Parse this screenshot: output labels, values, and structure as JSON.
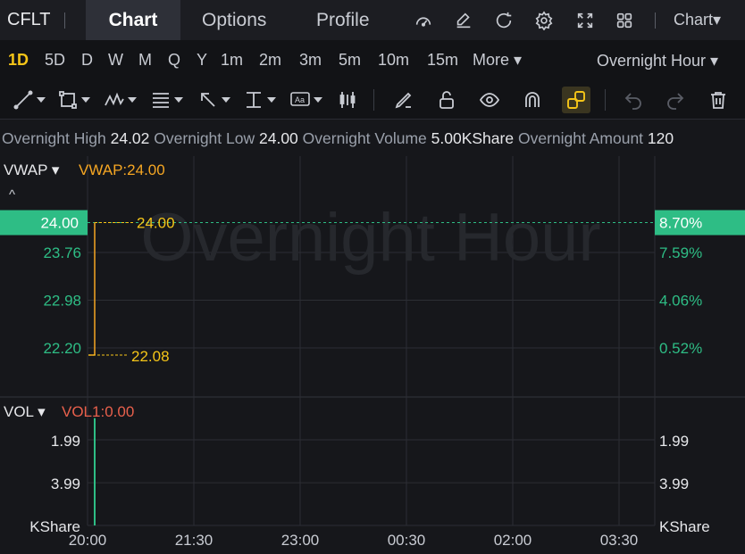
{
  "header": {
    "ticker": "CFLT",
    "tabs": [
      "Chart",
      "Options",
      "Profile"
    ],
    "active_tab": "Chart",
    "icons": [
      "gauge-icon",
      "edit-note-icon",
      "refresh-icon",
      "settings-gear-icon",
      "fullscreen-icon",
      "grid-layout-icon"
    ],
    "chart_menu_label": "Chart▾"
  },
  "intervals": {
    "items": [
      "1D",
      "5D",
      "D",
      "W",
      "M",
      "Q",
      "Y",
      "1m",
      "2m",
      "3m",
      "5m",
      "10m",
      "15m",
      "More ▾"
    ],
    "active": "1D",
    "session_select": "Overnight Hour ▾"
  },
  "toolbar": {
    "tools": [
      "line-tool-icon",
      "rectangle-tool-icon",
      "pattern-tool-icon",
      "fibonacci-tool-icon",
      "arrow-tool-icon",
      "measure-tool-icon",
      "text-note-tool-icon",
      "candlestick-tool-icon",
      "pencil-icon",
      "unlock-icon",
      "eye-icon",
      "magnet-icon",
      "link-toggle-icon",
      "undo-icon",
      "redo-icon",
      "trash-icon"
    ]
  },
  "stats": {
    "high_label": "Overnight High",
    "high_value": "24.02",
    "low_label": "Overnight Low",
    "low_value": "24.00",
    "volume_label": "Overnight Volume",
    "volume_value": "5.00KShare",
    "amount_label": "Overnight Amount",
    "amount_value": "120"
  },
  "price_panel": {
    "indicator_name": "VWAP ▾",
    "indicator_value": "VWAP:24.00",
    "collapse_glyph": "^",
    "watermark": "Overnight Hour",
    "current_price_tag": "24.00",
    "current_pct_tag": "8.70%",
    "left_ticks": [
      "23.76",
      "22.98",
      "22.20"
    ],
    "right_ticks": [
      "7.59%",
      "4.06%",
      "0.52%"
    ],
    "high_marker": "24.00",
    "low_marker": "22.08",
    "colors": {
      "up": "#2ebd85",
      "line": "#f5a623",
      "marker_text": "#f5c518",
      "tag_bg": "#2ebd85"
    }
  },
  "volume_panel": {
    "indicator_name": "VOL ▾",
    "indicator_value": "VOL1:0.00",
    "left_ticks": [
      "3.99",
      "1.99",
      "KShare"
    ],
    "right_ticks": [
      "3.99",
      "1.99",
      "KShare"
    ]
  },
  "time_axis": [
    "20:00",
    "21:30",
    "23:00",
    "00:30",
    "02:00",
    "03:30"
  ],
  "chart_data": [
    {
      "type": "line",
      "title": "",
      "series": [
        {
          "name": "VWAP",
          "x": [
            "20:00",
            "20:00",
            "20:00"
          ],
          "values": [
            22.08,
            24.0,
            24.0
          ]
        }
      ],
      "ylim": [
        22.08,
        24.02
      ],
      "y_ticks": [
        22.2,
        22.98,
        23.76
      ],
      "grid": true
    },
    {
      "type": "bar",
      "title": "",
      "categories": [
        "20:00"
      ],
      "values": [
        5.0
      ],
      "ylabel": "KShare",
      "y_ticks": [
        1.99,
        3.99
      ],
      "grid": true
    }
  ]
}
